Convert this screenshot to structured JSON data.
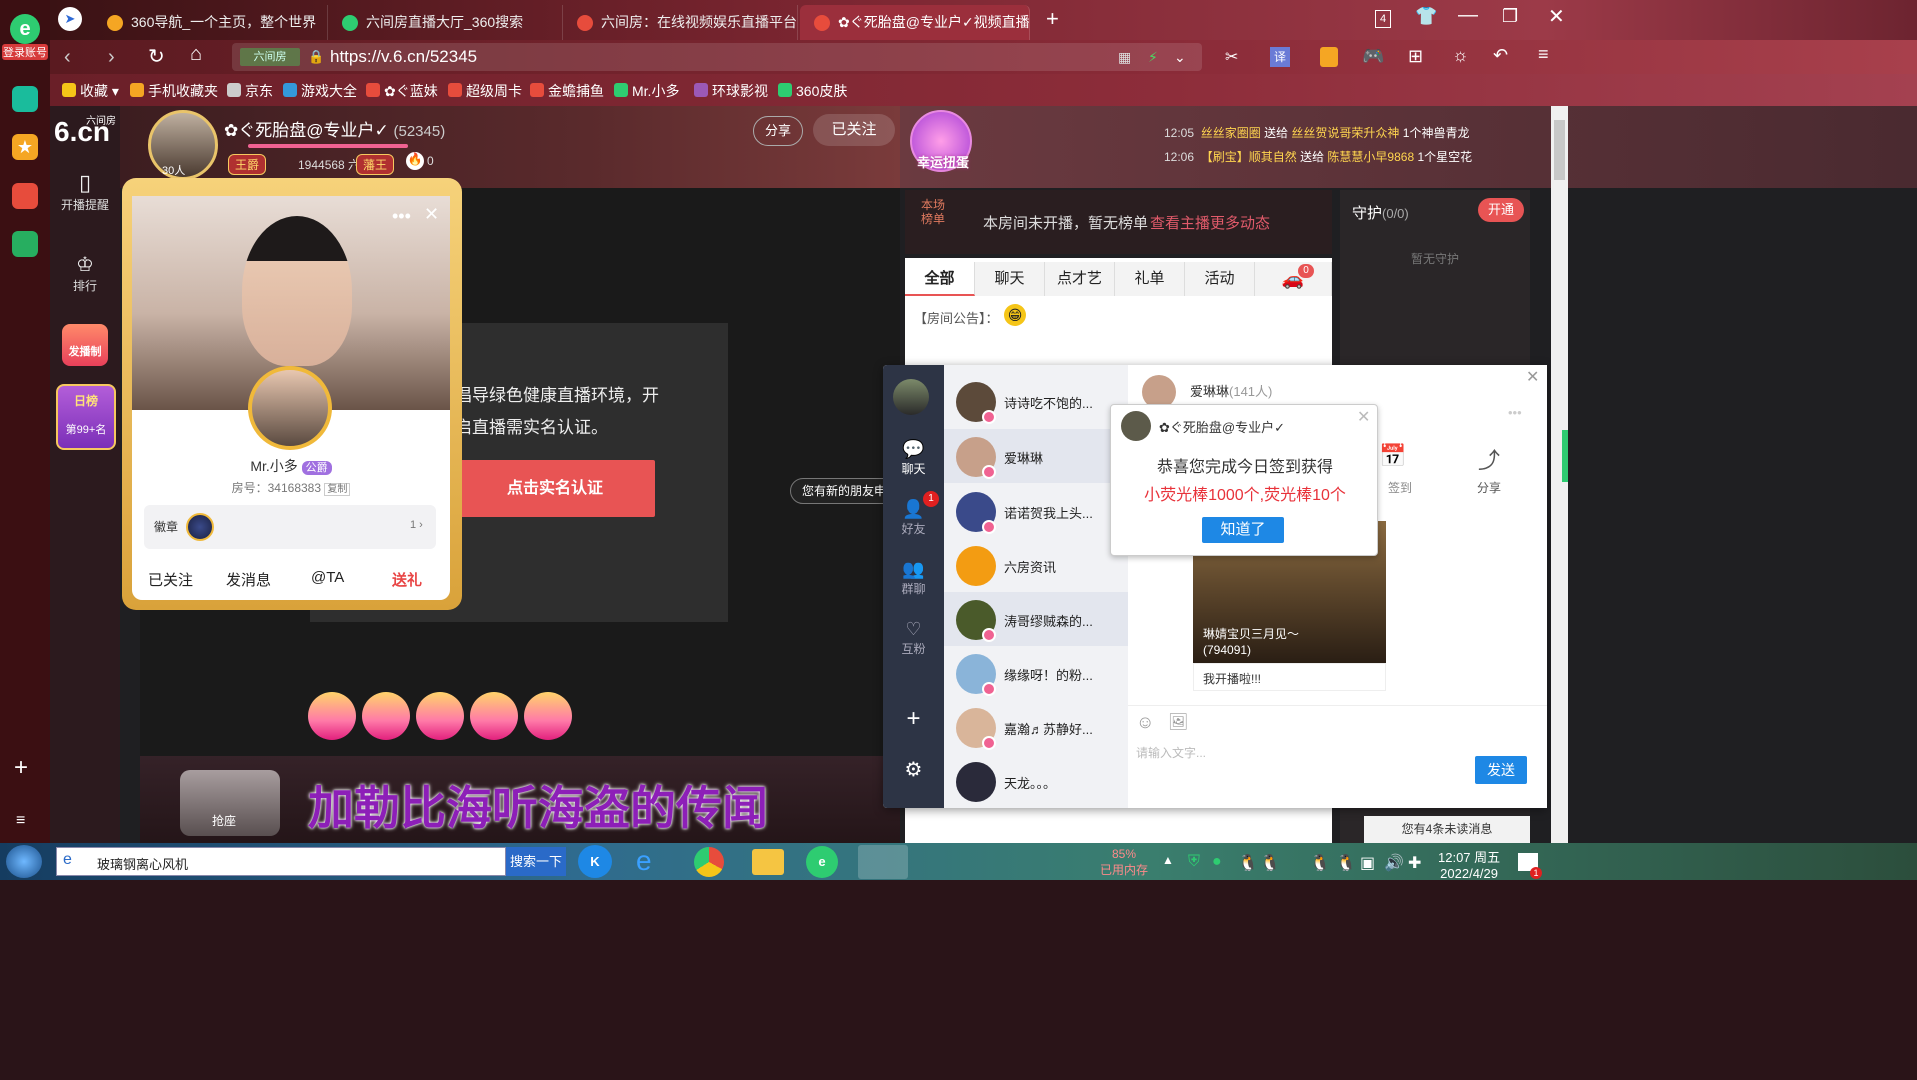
{
  "browser": {
    "sidebar": {
      "login_label": "登录账号"
    },
    "tabs": [
      {
        "label": "360导航_一个主页，整个世界",
        "color": "#f5a623"
      },
      {
        "label": "六间房直播大厅_360搜索",
        "color": "#2ecc71"
      },
      {
        "label": "六间房：在线视频娱乐直播平台",
        "color": "#e74c3c"
      },
      {
        "label": "✿ぐ死胎盘@专业户✓视频直播",
        "color": "#e74c3c"
      }
    ],
    "tab_counter": "4",
    "url": "https://v.6.cn/52345",
    "url_badge": "六间房",
    "translate_label": "译",
    "bookmarks": [
      "收藏",
      "手机收藏夹",
      "京东",
      "游戏大全",
      "✿ぐ蓝妹",
      "超级周卡",
      "金蟾捕鱼",
      "Mr.小多",
      "环球影视",
      "360皮肤"
    ]
  },
  "left_nav": {
    "logo_top": "六间房",
    "logo": "6.cn",
    "items": [
      "开播提醒",
      "排行"
    ],
    "promo": "发播制",
    "daily_rank_title": "日榜",
    "daily_rank_value": "第99+名"
  },
  "anchor": {
    "name": "✿ぐ死胎盘@专业户✓",
    "room_id": "(52345)",
    "fans": "30人",
    "badge_left": "王爵",
    "coins": "1944568 六币",
    "badge_right": "藩王",
    "fire_count": "0",
    "share": "分享",
    "followed": "已关注",
    "lucky_egg": "幸运扭蛋"
  },
  "gift_feed": [
    {
      "time": "12:05",
      "from": "丝丝家圈圈",
      "verb": "送给",
      "to": "丝丝贺说哥荣升众神",
      "item": "1个神兽青龙"
    },
    {
      "time": "12:06",
      "from": "【刷宝】顺其自然",
      "verb": "送给",
      "to": "陈慧慧小早9868",
      "item": "1个星空花"
    }
  ],
  "ranking": {
    "label_top": "本场",
    "label_bottom": "榜单",
    "text": "本房间未开播，暂无榜单",
    "link": "查看主播更多动态"
  },
  "chat": {
    "tabs": [
      "全部",
      "聊天",
      "点才艺",
      "礼单",
      "活动"
    ],
    "car_badge": "0",
    "announcement": "【房间公告】："
  },
  "guard": {
    "title": "守护",
    "count": "(0/0)",
    "button": "开通",
    "empty": "暂无守护"
  },
  "video_notice": {
    "line1": "倡导绿色健康直播环境，开",
    "line2": "启直播需实名认证。",
    "button": "点击实名认证"
  },
  "stage_bottom": {
    "marquee": "加勒比海听海盗的传闻",
    "seat_label": "抢座"
  },
  "profile_card": {
    "name": "Mr.小多",
    "rank_badge": "公爵",
    "room_no": "房号：34168383",
    "copy": "复制",
    "medal_label": "徽章",
    "medal_count": "1",
    "actions": [
      "已关注",
      "发消息",
      "@TA",
      "送礼"
    ]
  },
  "friend_toast": "您有新的朋友申请",
  "im": {
    "rail": [
      {
        "icon": "chat-icon",
        "label": "聊天"
      },
      {
        "icon": "friends-icon",
        "label": "好友",
        "badge": "1"
      },
      {
        "icon": "group-icon",
        "label": "群聊"
      },
      {
        "icon": "mutual-fans-icon",
        "label": "互粉"
      }
    ],
    "conversations": [
      {
        "name": "诗诗吃不饱的...",
        "color": "#5c4a3a"
      },
      {
        "name": "爱琳琳",
        "color": "#c7a08a"
      },
      {
        "name": "诺诺贺我上头...",
        "color": "#3a4a8a"
      },
      {
        "name": "六房资讯",
        "color": "#f39c12"
      },
      {
        "name": "涛哥缪贼森的...",
        "color": "#4a5a2a"
      },
      {
        "name": "缘缘呀！的粉...",
        "color": "#8ab4d9"
      },
      {
        "name": "嘉瀚♬苏静好...",
        "color": "#d9b59a"
      },
      {
        "name": "天龙。。。",
        "color": "#2a2a3a"
      }
    ],
    "header_name": "爱琳琳",
    "header_count": "(141人)",
    "share": "分享",
    "sign_in": "签到",
    "feed_name": "琳婧宝贝三月见～",
    "feed_id": "(794091)",
    "feed_text": "我开播啦!!!",
    "input_placeholder": "请输入文字...",
    "send": "发送",
    "unread": "您有4条未读消息"
  },
  "popup": {
    "title": "✿ぐ死胎盘@专业户✓",
    "line1": "恭喜您完成今日签到获得",
    "line2": "小荧光棒1000个,荧光棒10个",
    "button": "知道了"
  },
  "taskbar": {
    "search_text": "玻璃钢离心风机",
    "search_button": "搜索一下",
    "memory_percent": "85%",
    "memory_label": "已用内存",
    "time": "12:07 周五",
    "date": "2022/4/29",
    "notif_badge": "1"
  }
}
